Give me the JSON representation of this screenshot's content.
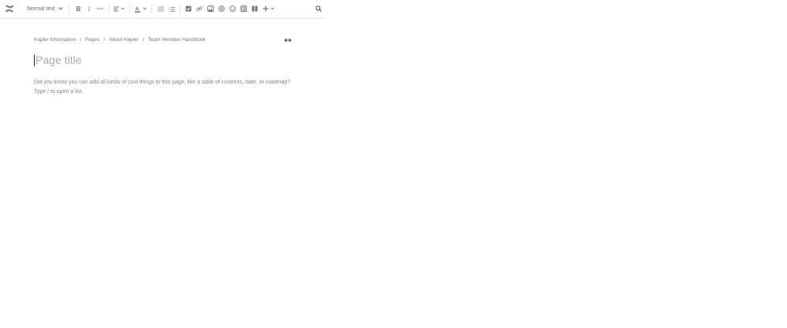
{
  "toolbar": {
    "text_style": "Normal text",
    "icons": [
      "confluence-logo",
      "bold-icon",
      "italic-icon",
      "more-formatting-icon",
      "align-icon",
      "text-color-icon",
      "bullet-list-icon",
      "numbered-list-icon",
      "task-icon",
      "link-icon",
      "image-icon",
      "mention-icon",
      "emoji-icon",
      "table-icon",
      "layout-icon",
      "insert-plus-icon",
      "search-icon"
    ],
    "text_color_accent": "#6554c0"
  },
  "breadcrumb": {
    "items": [
      "Kepler Information",
      "Pages",
      "About Kepler",
      "Team Member Handbook"
    ],
    "separator": "/"
  },
  "editor": {
    "title_placeholder": "Page title",
    "body_placeholder_line1": "Did you know you can add all kinds of cool things to this page, like a table of contents, date, or roadmap?",
    "body_placeholder_line2": "Type / to open a list."
  }
}
